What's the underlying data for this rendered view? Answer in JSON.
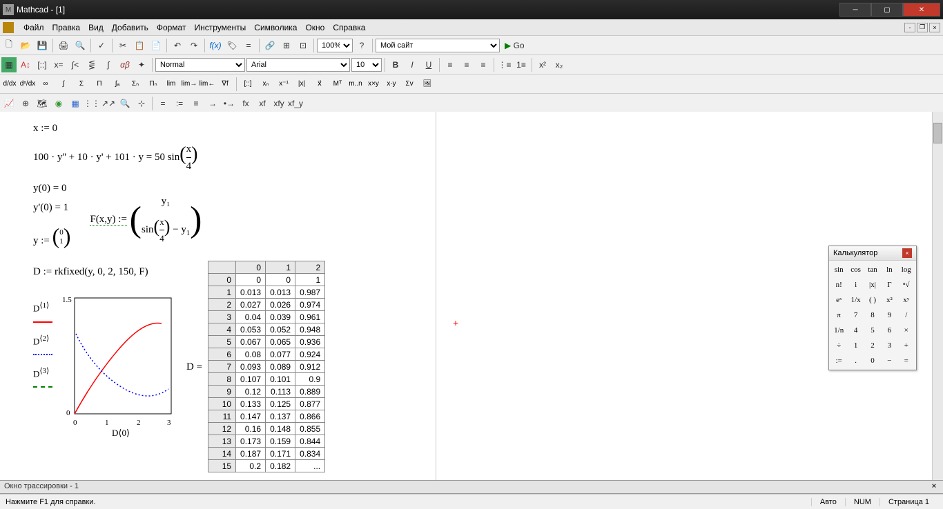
{
  "title": "Mathcad - [1]",
  "menu": [
    "Файл",
    "Правка",
    "Вид",
    "Добавить",
    "Формат",
    "Инструменты",
    "Символика",
    "Окно",
    "Справка"
  ],
  "toolbar1": {
    "zoom": "100%",
    "site": "Мой сайт",
    "go": "Go"
  },
  "format": {
    "style": "Normal",
    "font": "Arial",
    "size": "10"
  },
  "equations": {
    "e1": "x := 0",
    "e2": "100 · y'' + 10 · y' + 101 · y = 50 sin(x/4)",
    "e3": "y(0) = 0",
    "e4": "y'(0) = 1",
    "e5_lhs": "y :=",
    "e5_vec": [
      "0",
      "1"
    ],
    "e6_lhs": "F(x,y) :=",
    "e6_r1": "y₁",
    "e6_r2": "sin(x/4) − y₁",
    "e7": "D := rkfixed(y, 0, 2, 150, F)",
    "e8_lhs": "D ="
  },
  "chart_data": {
    "type": "line",
    "title": "",
    "xlabel": "D⟨0⟩",
    "ylabel": "",
    "xlim": [
      0,
      3
    ],
    "ylim": [
      0,
      1.5
    ],
    "xticks": [
      0,
      1,
      2,
      3
    ],
    "yticks": [
      0,
      1.5
    ],
    "series": [
      {
        "name": "D⟨1⟩",
        "color": "red",
        "style": "solid",
        "x": [
          0,
          0.25,
          0.5,
          0.75,
          1,
          1.25,
          1.5,
          1.75,
          2
        ],
        "y": [
          0,
          0.22,
          0.4,
          0.55,
          0.68,
          0.79,
          0.88,
          0.97,
          1.05
        ]
      },
      {
        "name": "D⟨2⟩",
        "color": "blue",
        "style": "dotted",
        "x": [
          0,
          0.25,
          0.5,
          0.75,
          1,
          1.25,
          1.5,
          1.75,
          2
        ],
        "y": [
          1.0,
          0.78,
          0.62,
          0.52,
          0.46,
          0.43,
          0.41,
          0.41,
          0.41
        ]
      },
      {
        "name": "D⟨3⟩",
        "color": "green",
        "style": "dashed",
        "x": [
          0,
          2
        ],
        "y": [
          0,
          0
        ]
      }
    ]
  },
  "table": {
    "cols": [
      "0",
      "1",
      "2"
    ],
    "rows": [
      [
        "0",
        "0",
        "0",
        "1"
      ],
      [
        "1",
        "0.013",
        "0.013",
        "0.987"
      ],
      [
        "2",
        "0.027",
        "0.026",
        "0.974"
      ],
      [
        "3",
        "0.04",
        "0.039",
        "0.961"
      ],
      [
        "4",
        "0.053",
        "0.052",
        "0.948"
      ],
      [
        "5",
        "0.067",
        "0.065",
        "0.936"
      ],
      [
        "6",
        "0.08",
        "0.077",
        "0.924"
      ],
      [
        "7",
        "0.093",
        "0.089",
        "0.912"
      ],
      [
        "8",
        "0.107",
        "0.101",
        "0.9"
      ],
      [
        "9",
        "0.12",
        "0.113",
        "0.889"
      ],
      [
        "10",
        "0.133",
        "0.125",
        "0.877"
      ],
      [
        "11",
        "0.147",
        "0.137",
        "0.866"
      ],
      [
        "12",
        "0.16",
        "0.148",
        "0.855"
      ],
      [
        "13",
        "0.173",
        "0.159",
        "0.844"
      ],
      [
        "14",
        "0.187",
        "0.171",
        "0.834"
      ],
      [
        "15",
        "0.2",
        "0.182",
        "..."
      ]
    ]
  },
  "calculator": {
    "title": "Калькулятор",
    "keys": [
      "sin",
      "cos",
      "tan",
      "ln",
      "log",
      "n!",
      "i",
      "|x|",
      "Γ",
      "ⁿ√",
      "eˣ",
      "1/x",
      "( )",
      "x²",
      "xʸ",
      "π",
      "7",
      "8",
      "9",
      "/",
      "1/n",
      "4",
      "5",
      "6",
      "×",
      "÷",
      "1",
      "2",
      "3",
      "+",
      ":=",
      ".",
      "0",
      "−",
      "="
    ]
  },
  "trace": "Окно трассировки - 1",
  "status": {
    "help": "Нажмите F1 для справки.",
    "auto": "Авто",
    "num": "NUM",
    "page": "Страница 1"
  }
}
